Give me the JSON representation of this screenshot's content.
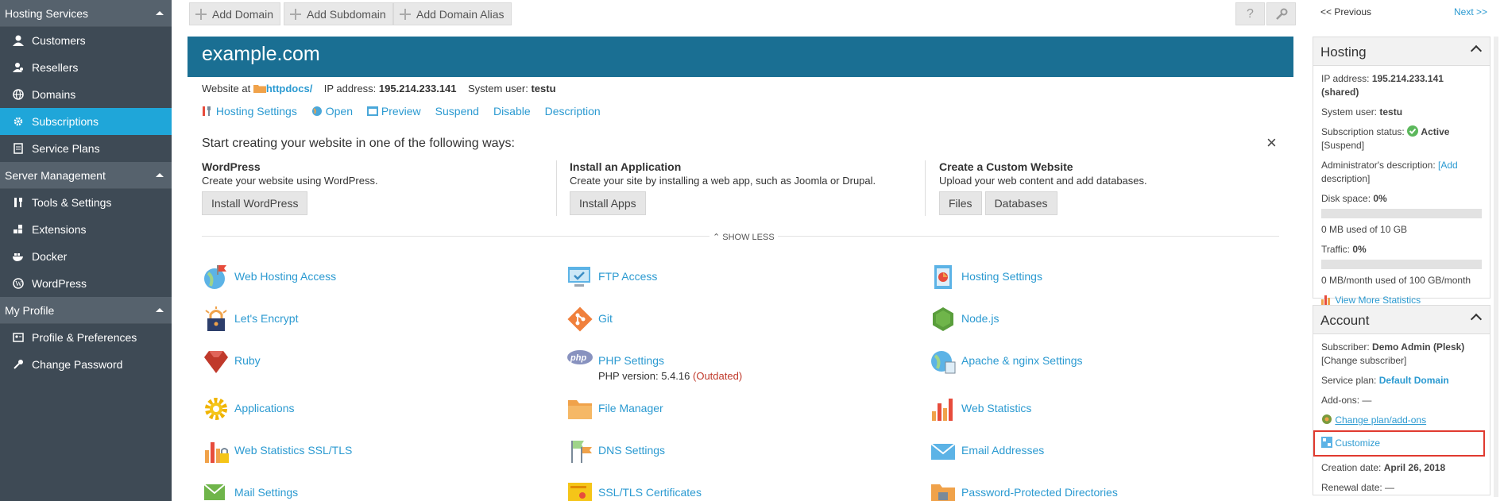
{
  "sidebar": {
    "sections": [
      {
        "label": "Hosting Services",
        "items": [
          "Customers",
          "Resellers",
          "Domains",
          "Subscriptions",
          "Service Plans"
        ]
      },
      {
        "label": "Server Management",
        "items": [
          "Tools & Settings",
          "Extensions",
          "Docker",
          "WordPress"
        ]
      },
      {
        "label": "My Profile",
        "items": [
          "Profile & Preferences",
          "Change Password"
        ]
      }
    ],
    "active_item": "Subscriptions"
  },
  "toolbar": {
    "add_domain": "Add Domain",
    "add_subdomain": "Add Subdomain",
    "add_domain_alias": "Add Domain Alias",
    "help": "?"
  },
  "domain": {
    "name": "example.com",
    "website_at_label": "Website at",
    "docroot": "httpdocs/",
    "ip_label": "IP address:",
    "ip": "195.214.233.141",
    "sysuser_label": "System user:",
    "sysuser": "testu",
    "actions": [
      "Hosting Settings",
      "Open",
      "Preview",
      "Suspend",
      "Disable",
      "Description"
    ]
  },
  "start": {
    "heading": "Start creating your website in one of the following ways:",
    "options": [
      {
        "title": "WordPress",
        "desc": "Create your website using WordPress.",
        "buttons": [
          "Install WordPress"
        ]
      },
      {
        "title": "Install an Application",
        "desc": "Create your site by installing a web app, such as Joomla or Drupal.",
        "buttons": [
          "Install Apps"
        ]
      },
      {
        "title": "Create a Custom Website",
        "desc": "Upload your web content and add databases.",
        "buttons": [
          "Files",
          "Databases"
        ]
      }
    ],
    "show_less": "SHOW LESS"
  },
  "tools": [
    [
      "Web Hosting Access",
      "FTP Access",
      "Hosting Settings"
    ],
    [
      "Let's Encrypt",
      "Git",
      "Node.js"
    ],
    [
      "Ruby",
      "PHP Settings",
      "Apache & nginx Settings"
    ],
    [
      "Applications",
      "File Manager",
      "Web Statistics"
    ],
    [
      "Web Statistics SSL/TLS",
      "DNS Settings",
      "Email Addresses"
    ],
    [
      "Mail Settings",
      "SSL/TLS Certificates",
      "Password-Protected Directories"
    ]
  ],
  "php": {
    "version_label": "PHP version: 5.4.16",
    "outdated": "(Outdated)"
  },
  "pager": {
    "previous": "<< Previous",
    "next": "Next >>"
  },
  "hosting_panel": {
    "title": "Hosting",
    "ip_label": "IP address:",
    "ip_value": "195.214.233.141 (shared)",
    "sysuser_label": "System user:",
    "sysuser_value": "testu",
    "status_label": "Subscription status:",
    "status_value": "Active",
    "suspend_link": "[Suspend]",
    "admin_desc_label": "Administrator's description:",
    "admin_desc_link_1": "[Add",
    "admin_desc_link_2": "description]",
    "disk_label": "Disk space:",
    "disk_value": "0%",
    "disk_used": "0 MB used of 10 GB",
    "traffic_label": "Traffic:",
    "traffic_value": "0%",
    "traffic_used": "0 MB/month used of 100 GB/month",
    "more_stats": "View More Statistics"
  },
  "account_panel": {
    "title": "Account",
    "subscriber_label": "Subscriber:",
    "subscriber_value": "Demo Admin (Plesk)",
    "change_subscriber": "[Change subscriber]",
    "plan_label": "Service plan:",
    "plan_value": "Default Domain",
    "addons": "Add-ons: —",
    "change_plan": "Change plan/add-ons",
    "customize": "Customize",
    "created_label": "Creation date:",
    "created_value": "April 26, 2018",
    "renewal": "Renewal date: —"
  },
  "colors": {
    "sidebar_bg": "#3e4a55",
    "active": "#1fa6d9",
    "header": "#1a6f93",
    "link": "#2b9ad1",
    "highlight": "#e03a2f",
    "outdated": "#c0392b"
  }
}
